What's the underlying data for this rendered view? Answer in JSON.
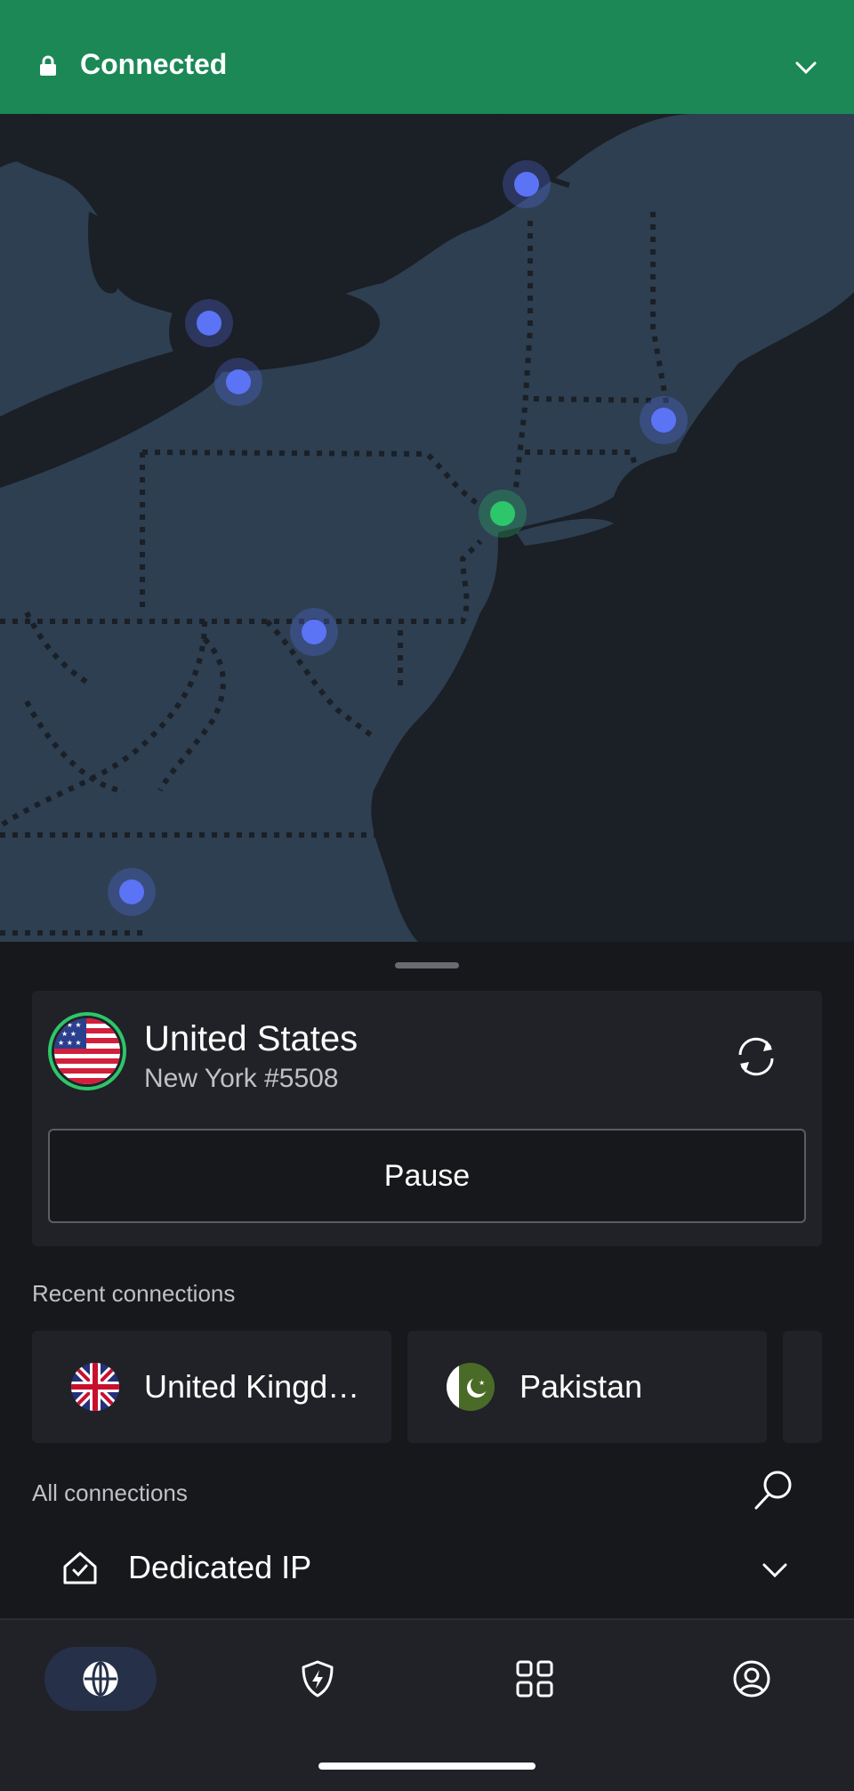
{
  "status": {
    "label": "Connected",
    "color": "#1b8856",
    "icons": {
      "lock": "lock-icon",
      "expand": "chevron-down-icon"
    }
  },
  "map": {
    "server_dot_color": "#5b73f5",
    "connected_dot_color": "#2dc66a"
  },
  "current_connection": {
    "country": "United States",
    "server": "New York #5508",
    "flag": "us-flag-icon",
    "refresh_icon": "refresh-icon",
    "pause_label": "Pause"
  },
  "recent": {
    "title": "Recent connections",
    "items": [
      {
        "name": "United Kingd…",
        "flag": "uk-flag-icon"
      },
      {
        "name": "Pakistan",
        "flag": "pakistan-flag-icon"
      }
    ]
  },
  "all": {
    "title": "All connections",
    "search_icon": "search-icon"
  },
  "dedicated": {
    "label": "Dedicated IP",
    "icon": "home-check-icon"
  },
  "nav": {
    "items": [
      {
        "name": "globe-icon",
        "active": true
      },
      {
        "name": "shield-bolt-icon",
        "active": false
      },
      {
        "name": "grid-icon",
        "active": false
      },
      {
        "name": "profile-icon",
        "active": false
      }
    ]
  }
}
